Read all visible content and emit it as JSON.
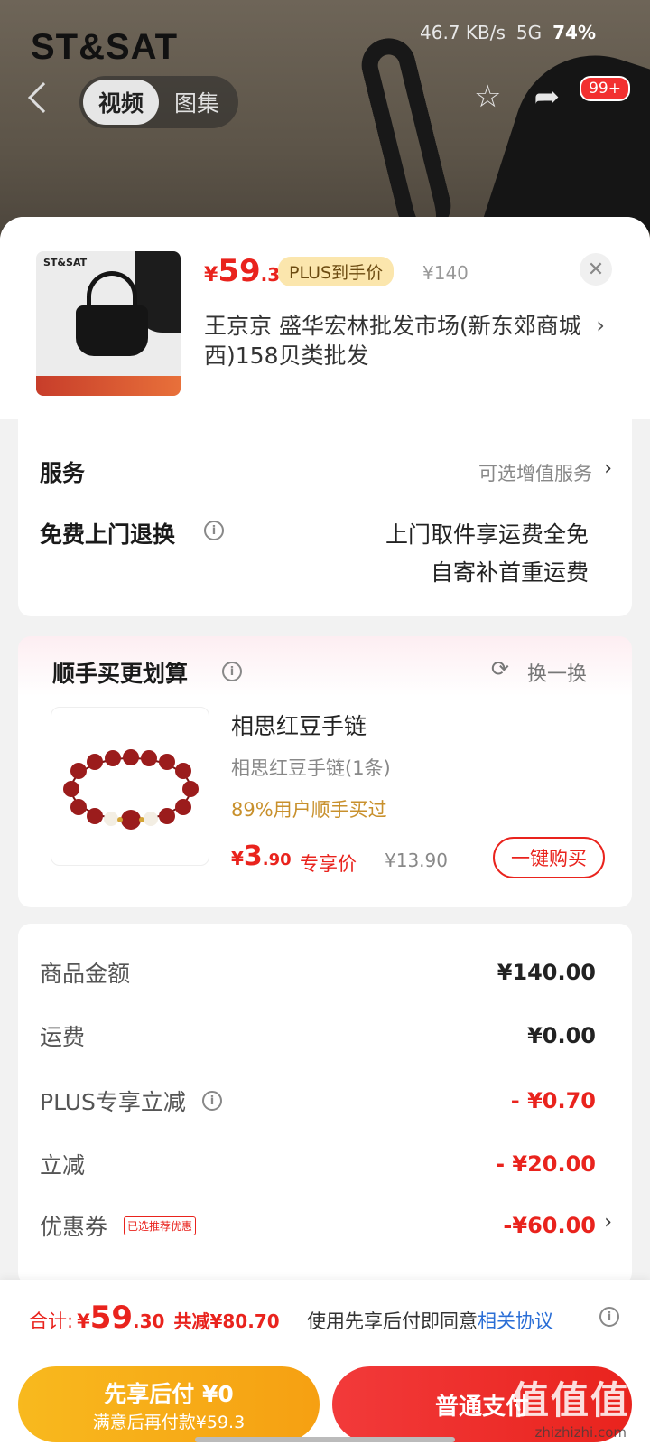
{
  "status": {
    "network": "46.7 KB/s",
    "signal": "5G",
    "battery": "74%"
  },
  "hero": {
    "brand": "ST&SAT",
    "tabs": [
      {
        "label": "视频",
        "active": true
      },
      {
        "label": "图集",
        "active": false
      }
    ],
    "badge": "99+"
  },
  "product": {
    "thumb_brand": "ST&SAT",
    "price_currency": "¥",
    "price_int": "59",
    "price_dec": ".3",
    "plus_tag": "PLUS到手价",
    "old_price": "¥140",
    "close": "✕",
    "store": "王京京  盛华宏林批发市场(新东郊商城西)158贝类批发"
  },
  "service": {
    "title": "服务",
    "option": "可选增值服务",
    "free_return": "免费上门退换",
    "line1": "上门取件享运费全免",
    "line2": "自寄补首重运费"
  },
  "upsell": {
    "title": "顺手买更划算",
    "swap": "换一换",
    "name": "相思红豆手链",
    "spec": "相思红豆手链(1条)",
    "buy_rate": "89%用户顺手买过",
    "price_currency": "¥",
    "price_int": "3",
    "price_dec": ".90",
    "exclusive": "专享价",
    "old_price": "¥13.90",
    "buy_button": "一键购买"
  },
  "summary": {
    "rows": [
      {
        "label": "商品金额",
        "value": "¥140.00"
      },
      {
        "label": "运费",
        "value": "¥0.00"
      },
      {
        "label": "PLUS专享立减",
        "value": "- ¥0.70"
      },
      {
        "label": "立减",
        "value": "- ¥20.00"
      },
      {
        "label": "优惠券",
        "value": "-¥60.00",
        "tag": "已选推荐优惠"
      }
    ]
  },
  "bottom": {
    "total_label": "合计:",
    "currency": "¥",
    "total_int": "59",
    "total_dec": ".30",
    "saved": "共减¥80.70",
    "agree_text": "使用先享后付即同意",
    "agree_link": "相关协议",
    "bnpl_title": "先享后付 ¥0",
    "bnpl_sub": "满意后再付款¥59.3",
    "pay_button": "普通支付",
    "watermark": "值值值",
    "watermark_url": "zhizhizhi.com"
  },
  "colors": {
    "accent_red": "#e9231d",
    "plus_gold": "#fbe6ad",
    "bnpl_orange": "#f6a012",
    "link_blue": "#2a6ed6"
  }
}
